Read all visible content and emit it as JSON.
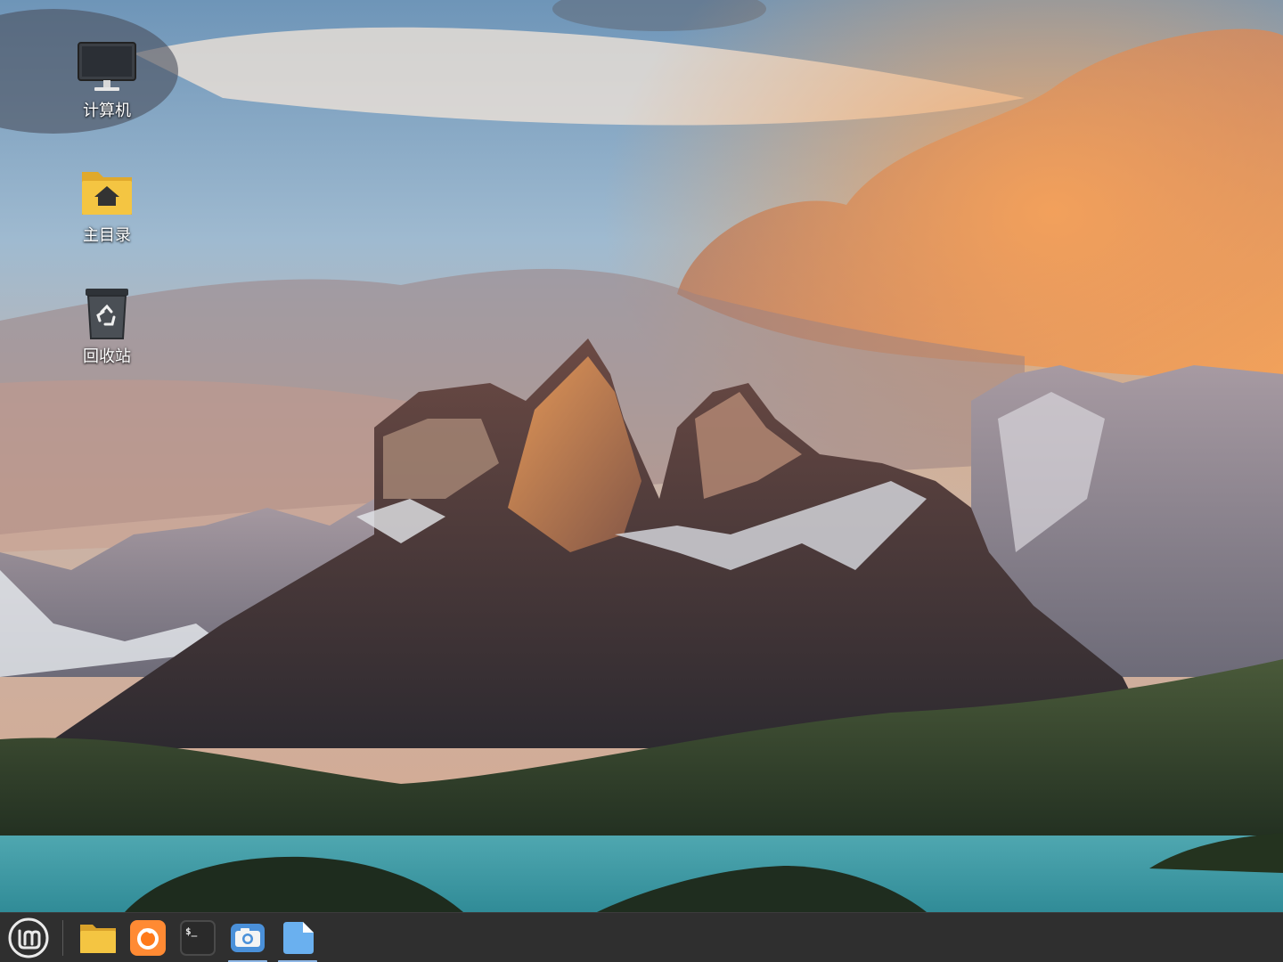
{
  "desktop": {
    "icons": [
      {
        "id": "computer",
        "label": "计算机",
        "icon": "monitor-icon"
      },
      {
        "id": "home",
        "label": "主目录",
        "icon": "home-folder-icon"
      },
      {
        "id": "trash",
        "label": "回收站",
        "icon": "trash-icon"
      }
    ]
  },
  "taskbar": {
    "menu_icon": "linux-mint-logo-icon",
    "launchers": [
      {
        "id": "files",
        "icon": "folder-icon",
        "active": false
      },
      {
        "id": "firefox",
        "icon": "firefox-icon",
        "active": false
      },
      {
        "id": "terminal",
        "icon": "terminal-icon",
        "active": false,
        "glyph": "$_"
      },
      {
        "id": "screenshot",
        "icon": "camera-icon",
        "active": true
      },
      {
        "id": "text-editor",
        "icon": "document-icon",
        "active": true
      }
    ]
  },
  "colors": {
    "taskbar_bg": "#2f2f2f",
    "active_indicator": "#8fb8e6",
    "folder_yellow": "#f4c542",
    "accent_blue": "#4a90d9"
  }
}
